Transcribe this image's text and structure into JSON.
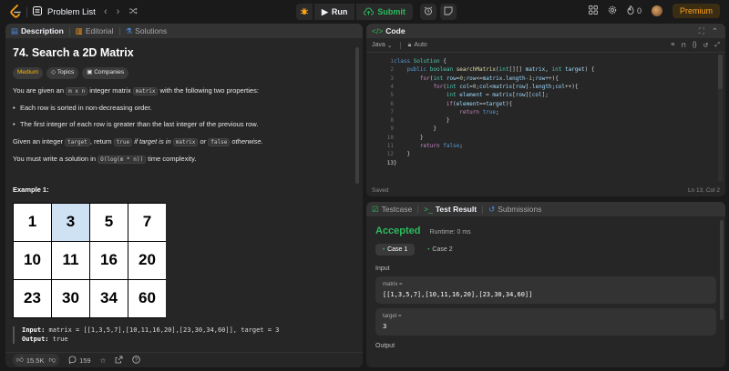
{
  "topbar": {
    "problem_list_label": "Problem List",
    "run_label": "Run",
    "submit_label": "Submit",
    "streak_count": "0",
    "premium_label": "Premium"
  },
  "description": {
    "tabs": [
      {
        "label": "Description"
      },
      {
        "label": "Editorial"
      },
      {
        "label": "Solutions"
      }
    ],
    "title": "74. Search a 2D Matrix",
    "tags": [
      "Medium",
      "Topics",
      "Companies"
    ],
    "intro_a": "You are given an ",
    "intro_code1": "m x n",
    "intro_b": " integer matrix ",
    "intro_code2": "matrix",
    "intro_c": " with the following two properties:",
    "bullets": [
      "Each row is sorted in non-decreasing order.",
      "The first integer of each row is greater than the last integer of the previous row."
    ],
    "task_a": "Given an integer ",
    "task_code1": "target",
    "task_b": ", return ",
    "task_code2": "true",
    "task_c": " if ",
    "task_d": "target",
    "task_e": " is in ",
    "task_code3": "matrix",
    "task_f": " or ",
    "task_code4": "false",
    "task_g": " otherwise.",
    "complexity_a": "You must write a solution in ",
    "complexity_code": "O(log(m * n))",
    "complexity_b": " time complexity.",
    "example_title": "Example 1:",
    "matrix": [
      [
        "1",
        "3",
        "5",
        "7"
      ],
      [
        "10",
        "11",
        "16",
        "20"
      ],
      [
        "23",
        "30",
        "34",
        "60"
      ]
    ],
    "highlight_value": "3",
    "input_label": "Input:",
    "input_value": " matrix = [[1,3,5,7],[10,11,16,20],[23,30,34,60]], target = 3",
    "output_label": "Output:",
    "output_value": " true",
    "likes": "15.5K",
    "comments": "159"
  },
  "code": {
    "tab_label": "Code",
    "language": "Java",
    "mode": "Auto",
    "status_left": "Saved",
    "status_right": "Ln 13, Col 2",
    "current_line": 13,
    "lines": [
      "class Solution {",
      "    public boolean searchMatrix(int[][] matrix, int target) {",
      "        for(int row=0;row<=matrix.length-1;row++){",
      "            for(int col=0;col<matrix[row].length;col++){",
      "                int element = matrix[row][col];",
      "                if(element==target){",
      "                    return true;",
      "                }",
      "            }",
      "        }",
      "        return false;",
      "    }",
      "}"
    ]
  },
  "tests": {
    "tabs": [
      {
        "label": "Testcase"
      },
      {
        "label": "Test Result"
      },
      {
        "label": "Submissions"
      }
    ],
    "status": "Accepted",
    "runtime": "Runtime: 0 ms",
    "cases": [
      "Case 1",
      "Case 2"
    ],
    "input_label": "Input",
    "params": [
      {
        "key": "matrix =",
        "value": "[[1,3,5,7],[10,11,16,20],[23,30,34,60]]"
      },
      {
        "key": "target =",
        "value": "3"
      }
    ],
    "output_label": "Output"
  }
}
